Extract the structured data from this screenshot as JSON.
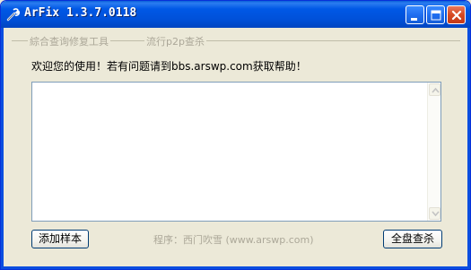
{
  "window": {
    "title": "ArFix 1.3.7.0118",
    "title_icon": "wrench-icon",
    "controls": {
      "minimize_icon": "minimize-icon",
      "maximize_icon": "maximize-icon",
      "close_icon": "close-icon"
    }
  },
  "tabs": [
    {
      "label": "綜合查询修复工具"
    },
    {
      "label": "流行p2p查杀"
    }
  ],
  "main": {
    "welcome_text": "欢迎您的使用！若有问题请到bbs.arswp.com获取帮助！",
    "log_text": ""
  },
  "buttons": {
    "add_sample": "添加样本",
    "full_scan": "全盘查杀"
  },
  "footer": {
    "credit": "程序：西门吹雪 (www.arswp.com)"
  },
  "colors": {
    "titlebar": "#0055e5",
    "window_bg": "#ece9d8",
    "disabled_text": "#aca899"
  }
}
